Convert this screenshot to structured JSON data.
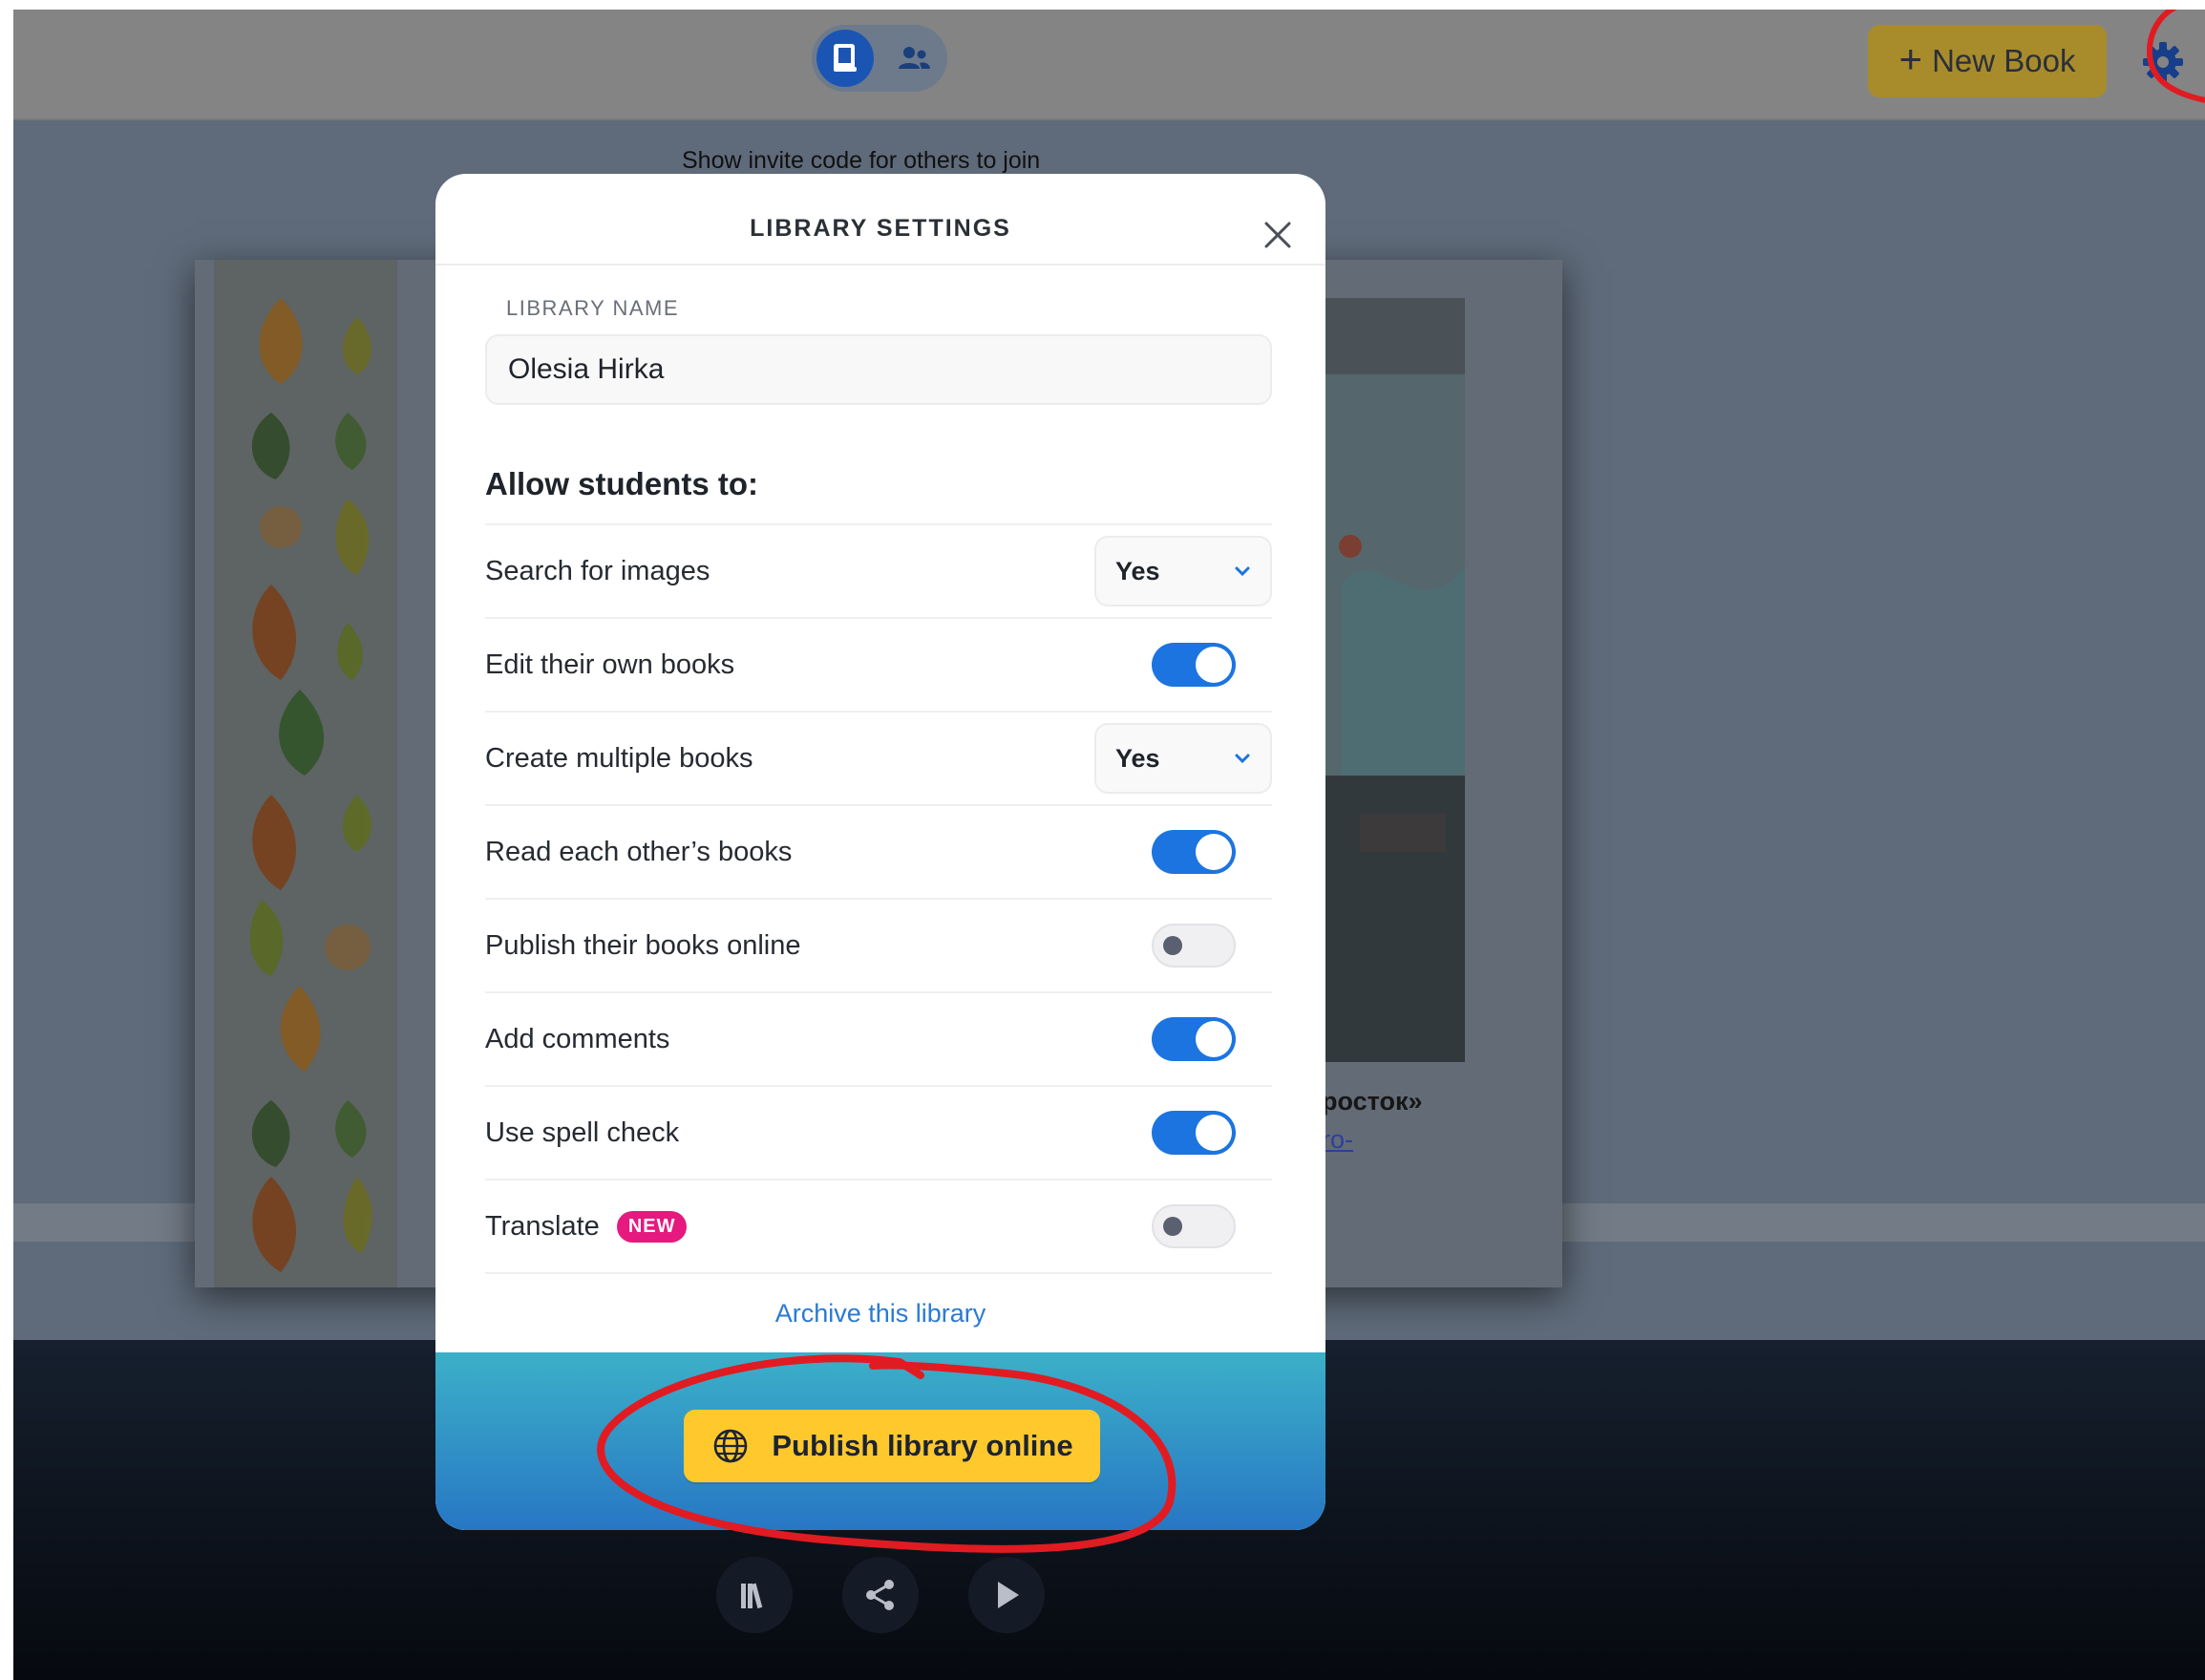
{
  "header": {
    "new_book_label": "New Book",
    "icons": [
      "book-icon",
      "people-icon",
      "gear-icon"
    ]
  },
  "background": {
    "invite_text": "Show invite code for others to join",
    "book_title_fragment": "росток»",
    "book_link_fragment": "ro-"
  },
  "modal": {
    "title": "LIBRARY SETTINGS",
    "library_name_label": "LIBRARY NAME",
    "library_name_value": "Olesia Hirka",
    "allow_title": "Allow students to:",
    "settings": [
      {
        "label": "Search for images",
        "control": "select",
        "value": "Yes"
      },
      {
        "label": "Edit their own books",
        "control": "toggle",
        "on": true
      },
      {
        "label": "Create multiple books",
        "control": "select",
        "value": "Yes"
      },
      {
        "label": "Read each other’s books",
        "control": "toggle",
        "on": true
      },
      {
        "label": "Publish their books online",
        "control": "toggle",
        "on": false
      },
      {
        "label": "Add comments",
        "control": "toggle",
        "on": true
      },
      {
        "label": "Use spell check",
        "control": "toggle",
        "on": true
      },
      {
        "label": "Translate",
        "control": "toggle",
        "on": false,
        "badge": "NEW"
      }
    ],
    "archive_link": "Archive this library",
    "publish_button": "Publish library online"
  },
  "colors": {
    "accent_blue": "#1b74e0",
    "publish_yellow": "#ffc92e",
    "new_badge": "#e5197e",
    "annotation_red": "#e11b22"
  }
}
